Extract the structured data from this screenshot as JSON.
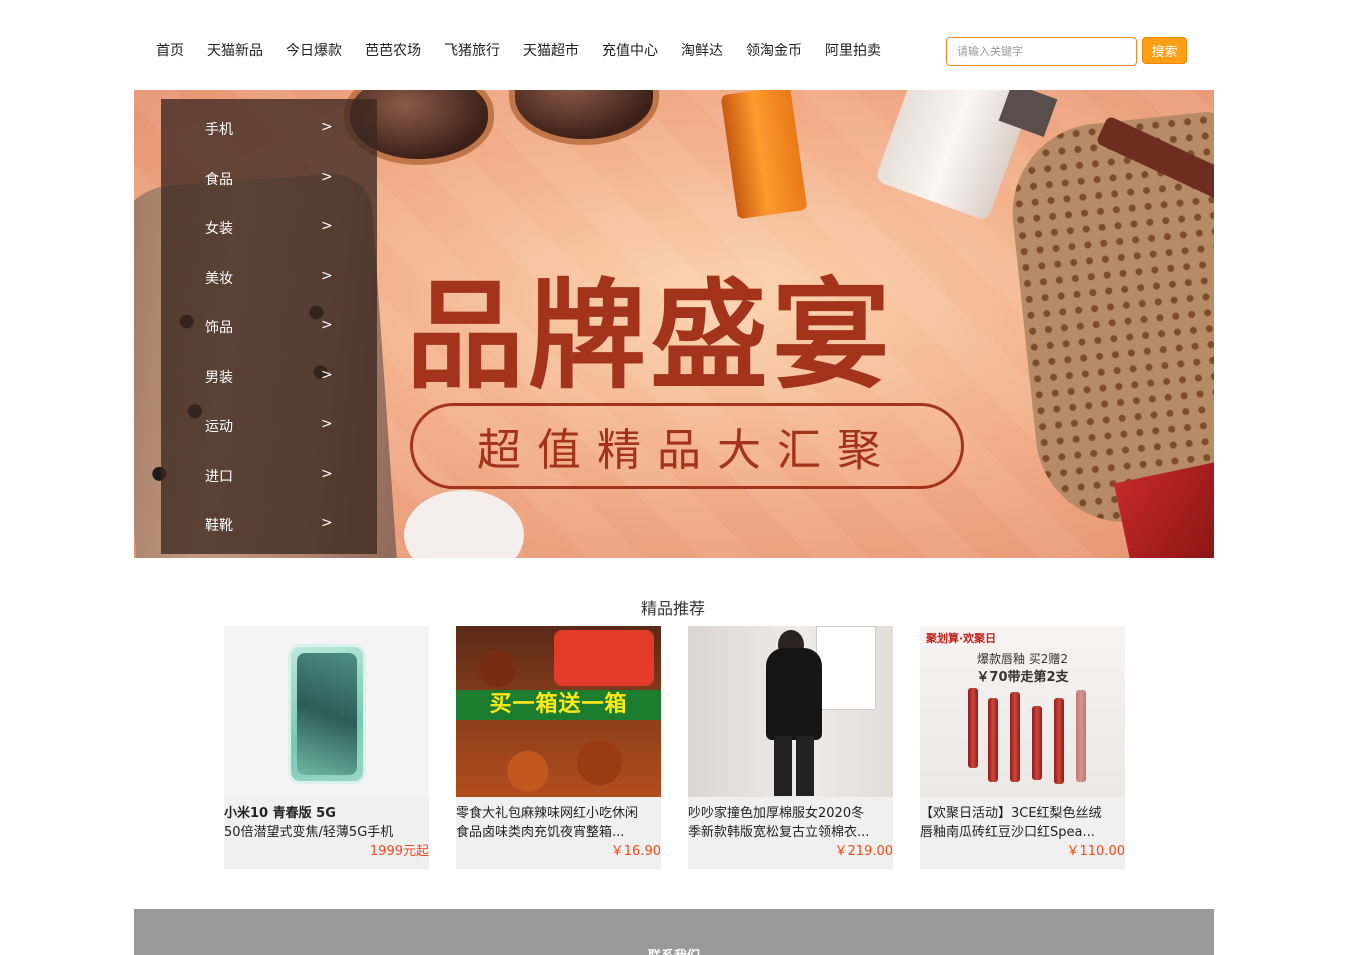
{
  "nav": {
    "links": [
      "首页",
      "天猫新品",
      "今日爆款",
      "芭芭农场",
      "飞猪旅行",
      "天猫超市",
      "充值中心",
      "淘鲜达",
      "领淘金币",
      "阿里拍卖"
    ],
    "search_placeholder": "请输入关键字",
    "search_button": "搜索",
    "accent_color": "#ff9f16"
  },
  "banner": {
    "headline": "品牌盛宴",
    "subheadline": "超值精品大汇聚"
  },
  "categories": [
    {
      "label": "手机",
      "arrow": ">"
    },
    {
      "label": "食品",
      "arrow": ">"
    },
    {
      "label": "女装",
      "arrow": ">"
    },
    {
      "label": "美妆",
      "arrow": ">"
    },
    {
      "label": "饰品",
      "arrow": ">"
    },
    {
      "label": "男装",
      "arrow": ">"
    },
    {
      "label": "运动",
      "arrow": ">"
    },
    {
      "label": "进口",
      "arrow": ">"
    },
    {
      "label": "鞋靴",
      "arrow": ">"
    }
  ],
  "recommend": {
    "title": "精品推荐",
    "products": [
      {
        "line1": "小米10 青春版 5G",
        "line2": "50倍潜望式变焦/轻薄5G手机",
        "price": "1999元起",
        "icon": "phone-image"
      },
      {
        "line1": "零食大礼包麻辣味网红小吃休闲",
        "line2": "食品卤味类肉充饥夜宵整箱...",
        "price": "￥16.90",
        "icon": "snack-image",
        "img_text": "买一箱送一箱"
      },
      {
        "line1": "吵吵家撞色加厚棉服女2020冬",
        "line2": "季新款韩版宽松复古立领棉衣...",
        "price": "￥219.00",
        "icon": "coat-image"
      },
      {
        "line1": "【欢聚日活动】3CE红梨色丝绒",
        "line2": "唇釉南瓜砖红豆沙口红Spea...",
        "price": "￥110.00",
        "icon": "lipstick-image",
        "img_top": "聚划算·欢聚日",
        "img_promo1": "爆款唇釉 买2赠2",
        "img_promo2": "￥70带走第2支"
      }
    ],
    "price_color": "#f04b1e"
  },
  "footer": {
    "title": "联系我们"
  }
}
